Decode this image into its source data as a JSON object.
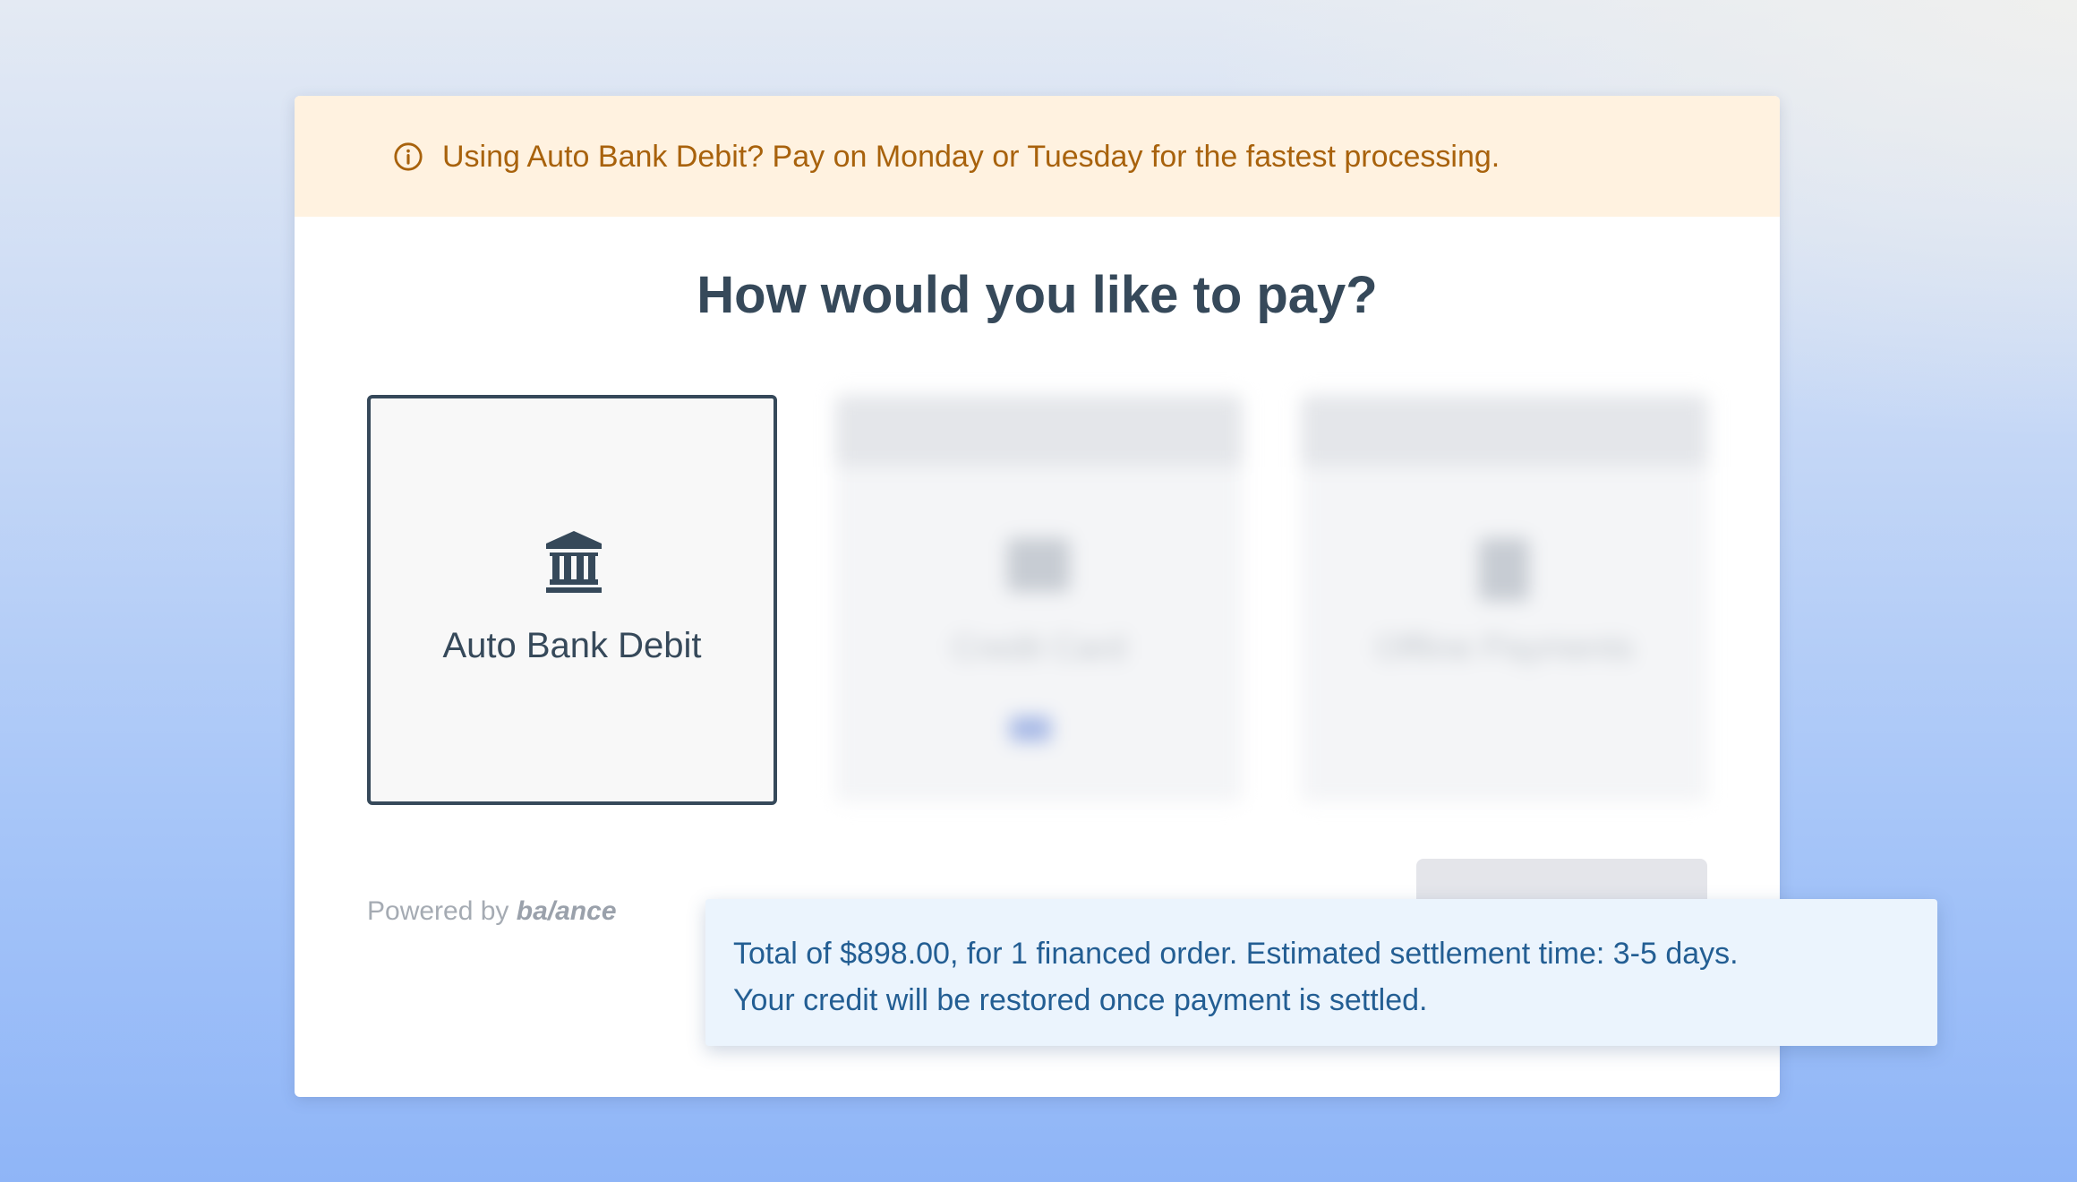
{
  "banner": {
    "icon": "info-circle-icon",
    "text": "Using Auto Bank Debit? Pay on Monday or Tuesday for the fastest processing.",
    "color": "#a8620c",
    "background": "#fff2e0"
  },
  "page_title": "How would you like to pay?",
  "payment_options": [
    {
      "label": "Auto Bank Debit",
      "icon": "bank-icon",
      "selected": true
    },
    {
      "label": "Credit Card",
      "icon": "credit-card-icon",
      "selected": false,
      "blurred": true
    },
    {
      "label": "Offline Payments",
      "icon": "document-icon",
      "selected": false,
      "blurred": true
    }
  ],
  "footer": {
    "powered_prefix": "Powered by",
    "brand": "ba/ance"
  },
  "tooltip": {
    "line1": "Total of $898.00, for 1 financed order. Estimated settlement time: 3-5 days.",
    "line2": "Your credit will be restored once payment is settled.",
    "color": "#235e93",
    "background": "#ebf4fd"
  }
}
